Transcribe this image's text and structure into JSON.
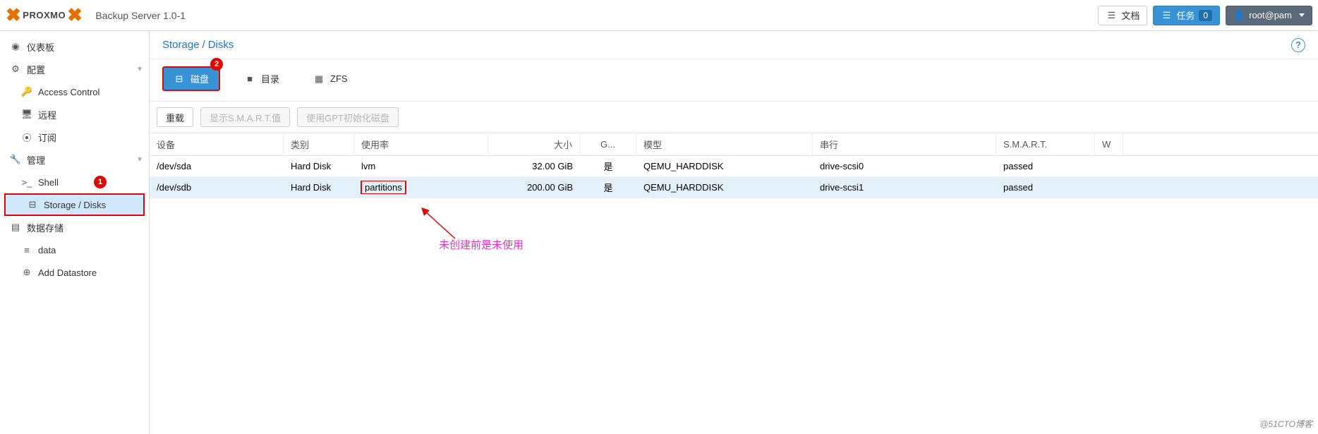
{
  "header": {
    "brand": "PROXMO",
    "subtitle": "Backup Server 1.0-1",
    "docs_label": "文档",
    "tasks_label": "任务",
    "tasks_count": "0",
    "user_label": "root@pam"
  },
  "sidebar": {
    "items": [
      {
        "label": "仪表板",
        "icon": "dashboard"
      },
      {
        "label": "配置",
        "icon": "gears",
        "expand": true
      },
      {
        "label": "Access Control",
        "icon": "key",
        "sub": true
      },
      {
        "label": "远程",
        "icon": "server",
        "sub": true
      },
      {
        "label": "订阅",
        "icon": "support",
        "sub": true
      },
      {
        "label": "管理",
        "icon": "wrench",
        "expand": true
      },
      {
        "label": "Shell",
        "icon": "terminal",
        "sub": true
      },
      {
        "label": "Storage / Disks",
        "icon": "hdd",
        "sub": true,
        "selected": true
      },
      {
        "label": "数据存储",
        "icon": "db-stack"
      },
      {
        "label": "data",
        "icon": "database",
        "sub": true
      },
      {
        "label": "Add Datastore",
        "icon": "plus",
        "sub": true
      }
    ]
  },
  "breadcrumb": {
    "a": "Storage",
    "b": "Disks"
  },
  "badges": {
    "one": "1",
    "two": "2"
  },
  "tabs": {
    "disks": "磁盘",
    "directory": "目录",
    "zfs": "ZFS"
  },
  "toolbar": {
    "reload": "重载",
    "smart": "显示S.M.A.R.T.值",
    "gpt": "使用GPT初始化磁盘"
  },
  "columns": {
    "device": "设备",
    "type": "类别",
    "usage": "使用率",
    "size": "大小",
    "gpt": "G...",
    "model": "模型",
    "serial": "串行",
    "smart": "S.M.A.R.T.",
    "wear": "W"
  },
  "rows": [
    {
      "device": "/dev/sda",
      "type": "Hard Disk",
      "usage": "lvm",
      "size": "32.00 GiB",
      "gpt": "是",
      "model": "QEMU_HARDDISK",
      "serial": "drive-scsi0",
      "smart": "passed"
    },
    {
      "device": "/dev/sdb",
      "type": "Hard Disk",
      "usage": "partitions",
      "size": "200.00 GiB",
      "gpt": "是",
      "model": "QEMU_HARDDISK",
      "serial": "drive-scsi1",
      "smart": "passed"
    }
  ],
  "annotation": "未创建前是未使用",
  "watermark": "@51CTO博客"
}
